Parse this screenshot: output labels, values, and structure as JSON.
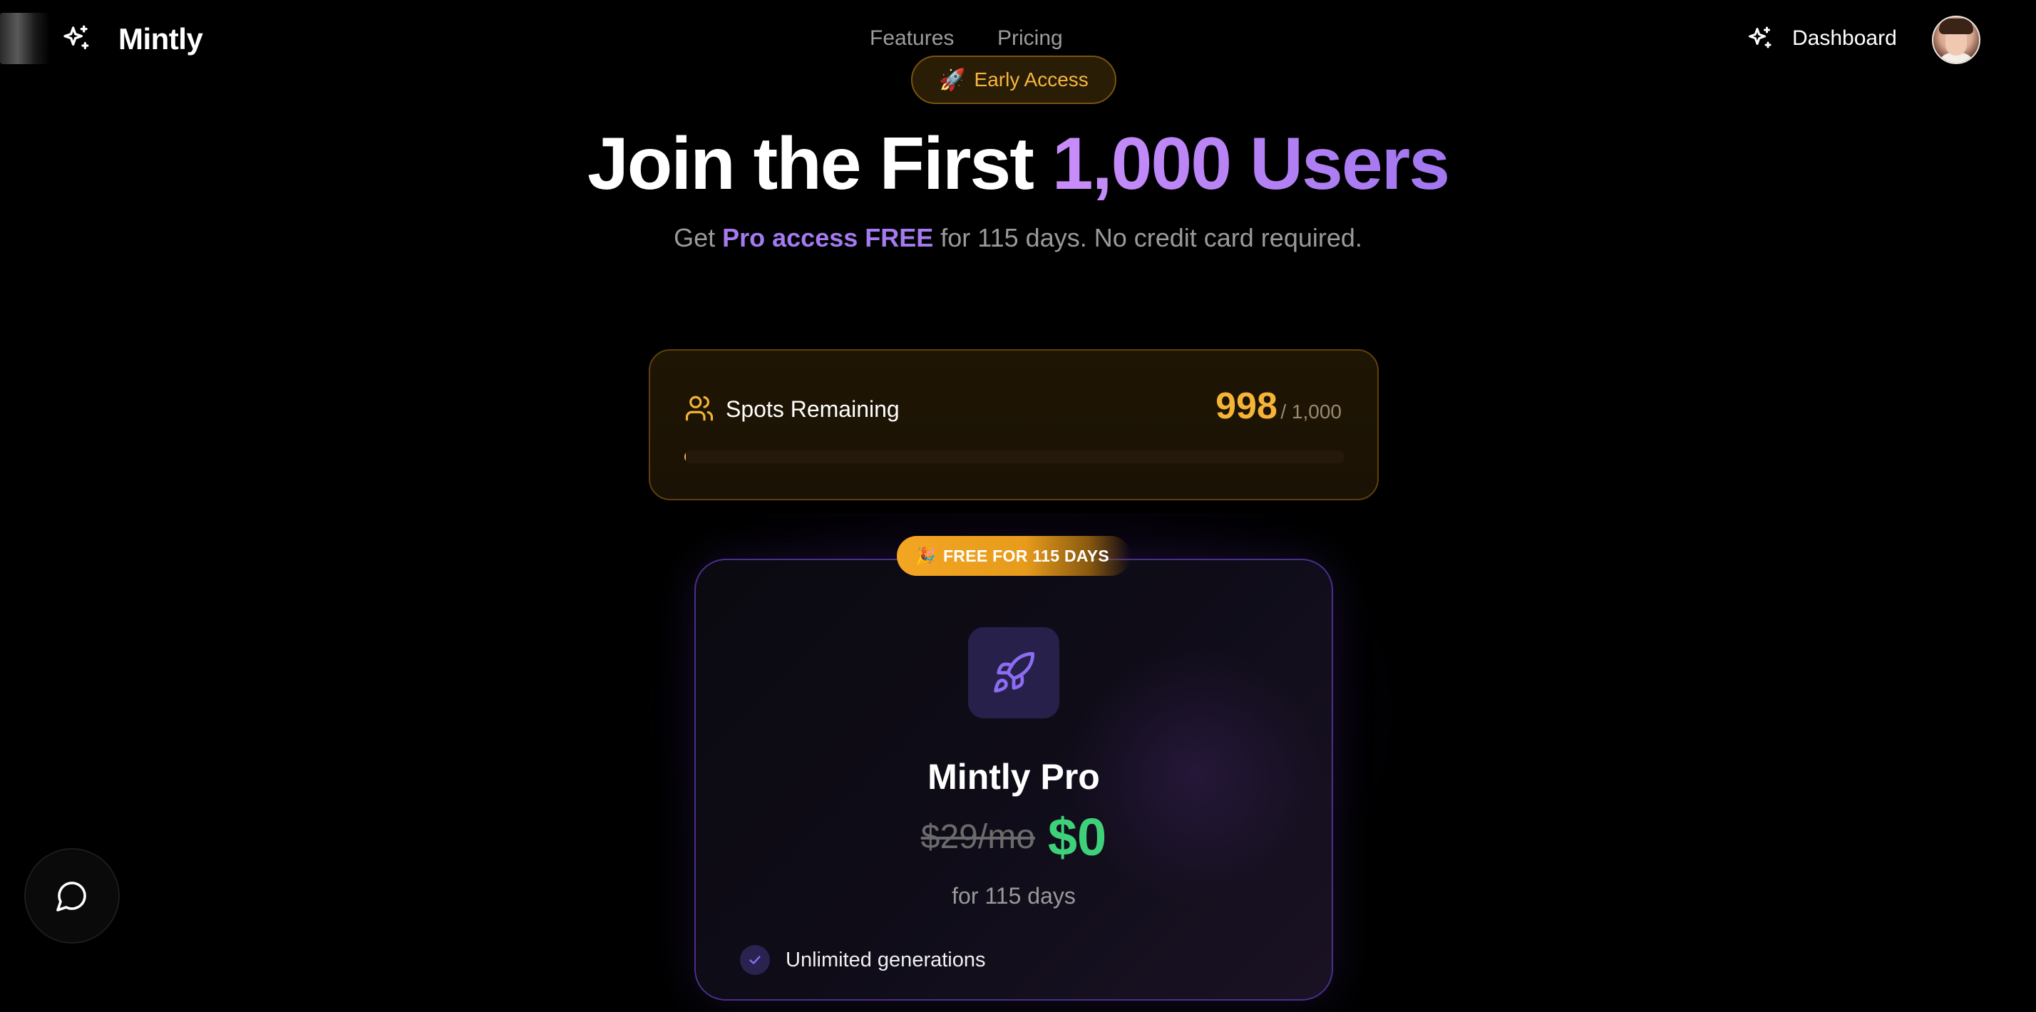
{
  "nav": {
    "brand": "Mintly",
    "links": [
      {
        "label": "Features"
      },
      {
        "label": "Pricing"
      }
    ],
    "dashboard_label": "Dashboard",
    "logo_icon": "sparkles-icon",
    "dashboard_icon": "sparkles-icon",
    "avatar": "user-avatar"
  },
  "badge": {
    "emoji": "🚀",
    "label": "Early Access"
  },
  "hero": {
    "headline_main": "Join the First ",
    "headline_accent": "1,000 Users",
    "sub_prefix": "Get ",
    "sub_highlight": "Pro access FREE",
    "sub_suffix": " for 115 days. No credit card required."
  },
  "spots": {
    "label": "Spots Remaining",
    "remaining": "998",
    "total": "/ 1,000",
    "claimed_fraction": 0.002,
    "icon": "users-icon"
  },
  "plan": {
    "pill_emoji": "🎉",
    "pill_label": "FREE FOR 115 DAYS",
    "icon": "rocket-icon",
    "name": "Mintly Pro",
    "old_price": "$29/mo",
    "new_price": "$0",
    "duration": "for 115 days",
    "features": [
      {
        "label": "Unlimited generations"
      }
    ]
  },
  "chat": {
    "icon": "chat-bubble-icon"
  },
  "colors": {
    "accent_purple": "#a57af0",
    "accent_gold": "#f5b436",
    "price_green": "#3fd17a",
    "background": "#000000"
  }
}
